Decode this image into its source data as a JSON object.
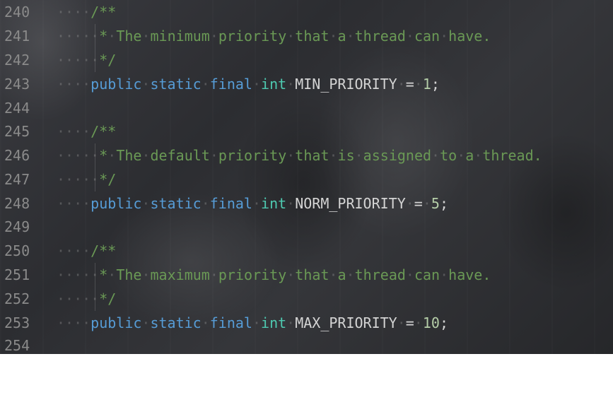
{
  "lines": [
    {
      "num": "240",
      "indent": "····",
      "comment": "/**"
    },
    {
      "num": "241",
      "indent": "·····",
      "comment": "*·The·minimum·priority·that·a·thread·can·have."
    },
    {
      "num": "242",
      "indent": "·····",
      "comment": "*/"
    },
    {
      "num": "243",
      "indent": "····",
      "kw1": "public",
      "kw2": "static",
      "kw3": "final",
      "type": "int",
      "name": "MIN_PRIORITY",
      "eq": "=",
      "value": "1",
      "semi": ";"
    },
    {
      "num": "244",
      "indent": ""
    },
    {
      "num": "245",
      "indent": "····",
      "comment": "/**"
    },
    {
      "num": "246",
      "indent": "·····",
      "comment": "*·The·default·priority·that·is·assigned·to·a·thread."
    },
    {
      "num": "247",
      "indent": "·····",
      "comment": "*/"
    },
    {
      "num": "248",
      "indent": "····",
      "kw1": "public",
      "kw2": "static",
      "kw3": "final",
      "type": "int",
      "name": "NORM_PRIORITY",
      "eq": "=",
      "value": "5",
      "semi": ";"
    },
    {
      "num": "249",
      "indent": ""
    },
    {
      "num": "250",
      "indent": "····",
      "comment": "/**"
    },
    {
      "num": "251",
      "indent": "·····",
      "comment": "*·The·maximum·priority·that·a·thread·can·have."
    },
    {
      "num": "252",
      "indent": "·····",
      "comment": "*/"
    },
    {
      "num": "253",
      "indent": "····",
      "kw1": "public",
      "kw2": "static",
      "kw3": "final",
      "type": "int",
      "name": "MAX_PRIORITY",
      "eq": "=",
      "value": "10",
      "semi": ";"
    },
    {
      "num": "254",
      "indent": ""
    }
  ],
  "colors": {
    "keyword": "#569cd6",
    "type": "#4ec9b0",
    "comment": "#6a9955",
    "number": "#b5cea8",
    "line_number": "#8a8a8a"
  }
}
